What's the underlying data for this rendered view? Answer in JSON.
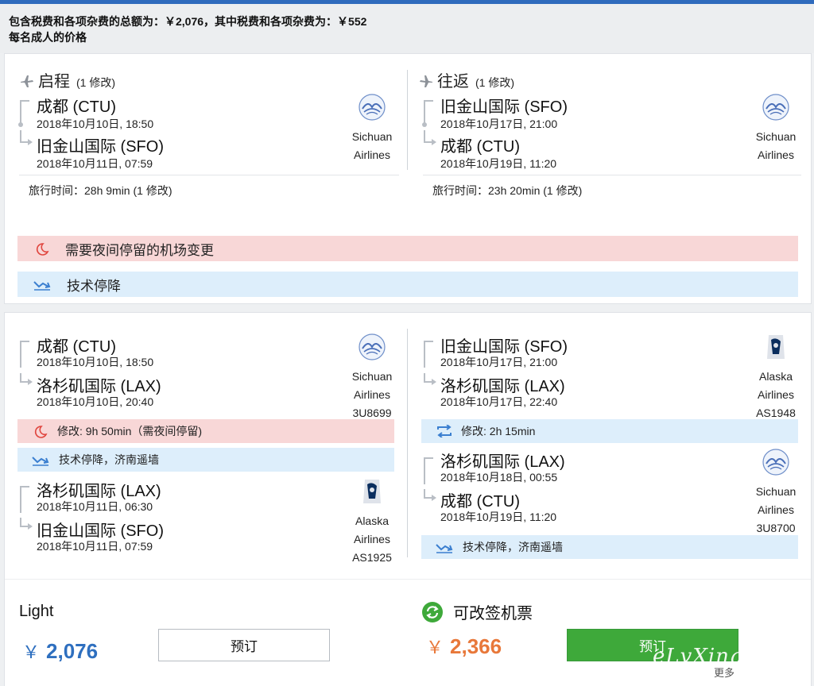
{
  "header": {
    "total_line": "包含税费和各项杂费的总额为：￥2,076，其中税费和各项杂费为：￥552",
    "per_adult": "每名成人的价格"
  },
  "summary": {
    "outbound": {
      "title": "启程",
      "stops": "(1 修改)",
      "from_city": "成都 (CTU)",
      "depart": "2018年10月10日, 18:50",
      "to_city": "旧金山国际 (SFO)",
      "arrive": "2018年10月11日, 07:59",
      "airline_line1": "Sichuan",
      "airline_line2": "Airlines",
      "travel_time": "旅行时间：28h 9min (1 修改)"
    },
    "return": {
      "title": "往返",
      "stops": "(1 修改)",
      "from_city": "旧金山国际 (SFO)",
      "depart": "2018年10月17日, 21:00",
      "to_city": "成都 (CTU)",
      "arrive": "2018年10月19日, 11:20",
      "airline_line1": "Sichuan",
      "airline_line2": "Airlines",
      "travel_time": "旅行时间：23h 20min (1 修改)"
    },
    "alert_overnight": "需要夜间停留的机场变更",
    "alert_tech_stop": "技术停降"
  },
  "details": {
    "outbound": {
      "seg1": {
        "from_city": "成都 (CTU)",
        "depart": "2018年10月10日, 18:50",
        "to_city": "洛杉矶国际 (LAX)",
        "arrive": "2018年10月10日, 20:40",
        "airline_line1": "Sichuan",
        "airline_line2": "Airlines",
        "flight_no": "3U8699"
      },
      "change": "修改: 9h 50min（需夜间停留)",
      "tech_stop": "技术停降，济南遥墙",
      "seg2": {
        "from_city": "洛杉矶国际 (LAX)",
        "depart": "2018年10月11日, 06:30",
        "to_city": "旧金山国际 (SFO)",
        "arrive": "2018年10月11日, 07:59",
        "airline_line1": "Alaska",
        "airline_line2": "Airlines",
        "flight_no": "AS1925"
      }
    },
    "return": {
      "seg1": {
        "from_city": "旧金山国际 (SFO)",
        "depart": "2018年10月17日, 21:00",
        "to_city": "洛杉矶国际 (LAX)",
        "arrive": "2018年10月17日, 22:40",
        "airline_line1": "Alaska",
        "airline_line2": "Airlines",
        "flight_no": "AS1948"
      },
      "change": "修改: 2h 15min",
      "seg2": {
        "from_city": "洛杉矶国际 (LAX)",
        "depart": "2018年10月18日, 00:55",
        "to_city": "成都 (CTU)",
        "arrive": "2018年10月19日, 11:20",
        "airline_line1": "Sichuan",
        "airline_line2": "Airlines",
        "flight_no": "3U8700"
      },
      "tech_stop": "技术停降，济南遥墙"
    }
  },
  "fares": {
    "light": {
      "name": "Light",
      "currency": "￥",
      "price": "2,076",
      "button": "预订"
    },
    "flex": {
      "name": "可改签机票",
      "currency": "￥",
      "price": "2,366",
      "button": "预订"
    },
    "more": "更多"
  },
  "watermark": "eLvXing.net",
  "colors": {
    "accent_blue": "#2e6fbf",
    "price_orange": "#e8783a",
    "book_green": "#3ea93a",
    "alert_red_bg": "#f8d7d7",
    "info_blue_bg": "#ddeefb",
    "moon_red": "#e0463f",
    "arrow_blue": "#3b7fd0"
  },
  "icons": {
    "plane_outbound": "plane-takeoff-icon",
    "plane_return": "plane-landing-icon",
    "overnight": "moon-icon",
    "tech_stop": "landing-arrow-icon",
    "connection": "swap-arrows-icon",
    "flex_fare": "refresh-circle-icon"
  }
}
